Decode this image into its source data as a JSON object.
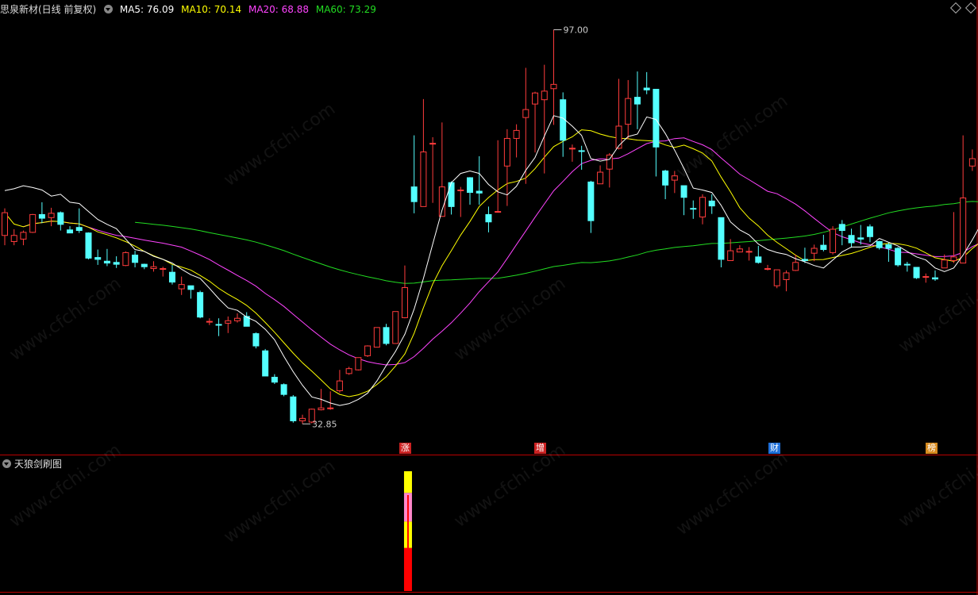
{
  "header": {
    "title": "思泉新材(日线 前复权)",
    "ma5": "MA5: 76.09",
    "ma10": "MA10: 70.14",
    "ma20": "MA20: 68.88",
    "ma60": "MA60: 73.29",
    "colors": {
      "ma5": "#ffffff",
      "ma10": "#ffff00",
      "ma20": "#ff44ff",
      "ma60": "#22dd22"
    }
  },
  "indicator": {
    "title": "天狼剑刷图"
  },
  "annotations": {
    "high": "97.00",
    "low": "32.85"
  },
  "badges": [
    {
      "text": "涨",
      "color": "#cc2222"
    },
    {
      "text": "增",
      "color": "#cc2222"
    },
    {
      "text": "财",
      "color": "#1e6fd9"
    },
    {
      "text": "榜",
      "color": "#d68a1e"
    }
  ],
  "watermark": "www.cfchi.com",
  "chart_data": {
    "type": "candlestick",
    "ylim": [
      30,
      99
    ],
    "colors": {
      "up": "#ff3c3c",
      "down": "#54ffff",
      "ma5": "#ffffff",
      "ma10": "#ffff00",
      "ma20": "#ff44ff",
      "ma60": "#22dd22"
    },
    "candles": [
      [
        63.5,
        67.2,
        67.9,
        61.9
      ],
      [
        62.5,
        63.5,
        64.5,
        61.9
      ],
      [
        62.9,
        64.0,
        64.3,
        61.9
      ],
      [
        64.0,
        66.9,
        67.0,
        63.9
      ],
      [
        66.9,
        66.3,
        68.9,
        65.5
      ],
      [
        66.4,
        67.1,
        68.0,
        65.0
      ],
      [
        67.2,
        65.3,
        67.4,
        64.3
      ],
      [
        64.4,
        63.9,
        65.0,
        63.9
      ],
      [
        64.8,
        64.3,
        67.9,
        63.9
      ],
      [
        63.9,
        59.8,
        64.0,
        59.6
      ],
      [
        59.9,
        59.6,
        61.2,
        58.7
      ],
      [
        59.3,
        59.0,
        61.3,
        58.5
      ],
      [
        59.1,
        58.8,
        60.1,
        58.2
      ],
      [
        58.6,
        60.7,
        60.9,
        58.5
      ],
      [
        60.3,
        59.1,
        61.0,
        58.3
      ],
      [
        58.8,
        58.4,
        58.9,
        58.0
      ],
      [
        58.1,
        58.4,
        59.3,
        57.6
      ],
      [
        58.1,
        58.1,
        58.4,
        56.8
      ],
      [
        57.5,
        55.9,
        58.7,
        55.5
      ],
      [
        54.8,
        55.5,
        56.8,
        53.8
      ],
      [
        55.3,
        54.7,
        55.3,
        53.2
      ],
      [
        54.2,
        50.2,
        54.5,
        50.0
      ],
      [
        49.5,
        49.5,
        50.0,
        48.9
      ],
      [
        49.0,
        48.9,
        50.0,
        47.1
      ],
      [
        49.2,
        49.6,
        50.3,
        47.6
      ],
      [
        49.6,
        50.0,
        50.8,
        49.3
      ],
      [
        50.3,
        48.7,
        51.0,
        48.7
      ],
      [
        47.5,
        45.5,
        47.7,
        45.1
      ],
      [
        44.7,
        40.6,
        45.0,
        40.6
      ],
      [
        40.4,
        39.6,
        40.9,
        39.3
      ],
      [
        39.2,
        37.6,
        39.4,
        37.3
      ],
      [
        37.2,
        33.3,
        37.5,
        33.0
      ],
      [
        33.3,
        33.7,
        34.3,
        32.8
      ],
      [
        33.1,
        35.2,
        35.3,
        32.9
      ],
      [
        35.1,
        35.4,
        38.5,
        35.0
      ],
      [
        35.3,
        35.4,
        38.1,
        35.1
      ],
      [
        38.2,
        39.8,
        41.6,
        37.9
      ],
      [
        41.0,
        41.8,
        42.1,
        40.8
      ],
      [
        41.6,
        43.6,
        43.6,
        41.5
      ],
      [
        43.9,
        45.5,
        45.6,
        43.7
      ],
      [
        45.3,
        48.5,
        48.5,
        45.3
      ],
      [
        48.5,
        45.9,
        49.1,
        45.6
      ],
      [
        45.9,
        51.1,
        51.0,
        47.2
      ],
      [
        50.1,
        55.0,
        58.6,
        50.0
      ],
      [
        71.4,
        69.0,
        79.8,
        67.1
      ],
      [
        68.2,
        77.1,
        85.7,
        68.3
      ],
      [
        78.5,
        78.5,
        79.5,
        68.8
      ],
      [
        66.6,
        71.4,
        81.9,
        68.5
      ],
      [
        72.1,
        68.2,
        72.3,
        66.9
      ],
      [
        70.9,
        70.9,
        71.4,
        66.5
      ],
      [
        72.9,
        70.5,
        73.0,
        68.5
      ],
      [
        70.7,
        70.4,
        76.4,
        68.5
      ],
      [
        66.9,
        65.7,
        68.2,
        64.0
      ],
      [
        67.4,
        67.4,
        79.0,
        67.2
      ],
      [
        74.8,
        79.3,
        80.8,
        68.3
      ],
      [
        79.3,
        80.6,
        81.6,
        76.2
      ],
      [
        82.7,
        84.0,
        90.8,
        71.9
      ],
      [
        84.9,
        86.7,
        86.9,
        77.0
      ],
      [
        85.6,
        87.0,
        91.3,
        73.6
      ],
      [
        87.4,
        88.1,
        97.0,
        81.5
      ],
      [
        85.6,
        79.0,
        86.8,
        76.3
      ],
      [
        77.7,
        77.7,
        78.3,
        75.5
      ],
      [
        77.3,
        77.2,
        78.1,
        74.2
      ],
      [
        72.2,
        65.9,
        72.4,
        63.9
      ],
      [
        71.9,
        73.8,
        74.9,
        72.8
      ],
      [
        74.3,
        76.6,
        76.9,
        71.3
      ],
      [
        77.7,
        81.3,
        89.0,
        77.5
      ],
      [
        81.6,
        85.8,
        88.8,
        79.2
      ],
      [
        86.0,
        84.9,
        90.2,
        80.8
      ],
      [
        87.5,
        87.2,
        90.1,
        86.5
      ],
      [
        87.3,
        77.9,
        87.3,
        73.1
      ],
      [
        74.0,
        71.7,
        74.2,
        69.4
      ],
      [
        72.5,
        73.2,
        74.0,
        70.4
      ],
      [
        71.6,
        69.7,
        71.6,
        66.8
      ],
      [
        67.9,
        67.8,
        69.2,
        66.2
      ],
      [
        66.5,
        69.7,
        70.2,
        65.3
      ],
      [
        69.1,
        68.3,
        70.2,
        67.0
      ],
      [
        66.4,
        59.6,
        66.4,
        58.3
      ],
      [
        59.4,
        61.0,
        62.9,
        60.4
      ],
      [
        60.8,
        61.3,
        61.9,
        60.9
      ],
      [
        60.9,
        60.9,
        61.6,
        59.4
      ],
      [
        60.0,
        59.1,
        61.8,
        58.9
      ],
      [
        58.1,
        58.1,
        58.7,
        57.8
      ],
      [
        55.3,
        57.9,
        57.9,
        54.9
      ],
      [
        56.3,
        57.4,
        57.8,
        54.4
      ],
      [
        57.8,
        59.1,
        60.4,
        57.7
      ],
      [
        59.6,
        59.4,
        61.5,
        59.0
      ],
      [
        60.6,
        61.4,
        62.0,
        59.3
      ],
      [
        61.9,
        61.2,
        63.6,
        60.9
      ],
      [
        60.7,
        64.5,
        65.0,
        60.4
      ],
      [
        65.3,
        64.3,
        66.0,
        61.9
      ],
      [
        63.5,
        62.3,
        64.6,
        61.5
      ],
      [
        63.1,
        62.9,
        65.2,
        62.0
      ],
      [
        64.9,
        63.3,
        65.3,
        62.4
      ],
      [
        62.5,
        61.5,
        62.6,
        61.2
      ],
      [
        62.0,
        61.4,
        62.3,
        59.2
      ],
      [
        61.4,
        58.7,
        61.6,
        58.4
      ],
      [
        58.8,
        58.7,
        59.2,
        57.6
      ],
      [
        58.3,
        56.6,
        58.3,
        56.4
      ],
      [
        56.7,
        56.8,
        57.3,
        55.8
      ],
      [
        56.6,
        56.4,
        57.8,
        56.1
      ],
      [
        58.2,
        59.5,
        60.4,
        59.1
      ],
      [
        59.4,
        60.0,
        67.3,
        59.0
      ],
      [
        59.0,
        69.6,
        79.8,
        59.3
      ],
      [
        74.8,
        76.0,
        77.5,
        74.0
      ],
      [
        76.1,
        73.0,
        81.9,
        73.6
      ],
      [
        69.8,
        71.6,
        77.8,
        68.9
      ]
    ],
    "ma5": [
      70.8,
      71.1,
      71.6,
      71.3,
      70.9,
      69.9,
      70.2,
      68.9,
      68.7,
      67.4,
      66.1,
      65.3,
      64.6,
      62.9,
      61.2,
      60.9,
      60.1,
      59.6,
      59.0,
      58.0,
      57.1,
      56.5,
      54.9,
      53.2,
      51.7,
      51.3,
      50.2,
      49.5,
      48.2,
      46.5,
      43.8,
      41.3,
      39.1,
      37.2,
      36.8,
      36.2,
      35.8,
      36.1,
      36.8,
      37.8,
      39.8,
      42.3,
      44.6,
      47.4,
      51.5,
      56.5,
      62.1,
      67.6,
      72.1,
      73.6,
      74.0,
      73.6,
      71.8,
      70.6,
      70.1,
      71.5,
      74.1,
      76.2,
      79.7,
      83.0,
      82.6,
      81.3,
      79.8,
      76.0,
      75.6,
      75.9,
      78.1,
      79.6,
      80.0,
      82.8,
      82.4,
      80.1,
      77.4,
      74.4,
      71.2,
      70.9,
      70.5,
      68.4,
      65.7,
      64.4,
      63.6,
      62.1,
      61.2,
      60.7,
      60.4,
      59.7,
      59.2,
      58.6,
      58.2,
      59.5,
      60.8,
      61.6,
      61.6,
      61.8,
      63.0,
      62.4,
      61.8,
      60.9,
      60.0,
      59.5,
      58.2,
      57.6,
      58.2,
      60.3,
      62.8,
      65.5,
      69.4
    ]
  },
  "indicator_bar": {
    "segments": [
      {
        "from": 0.0,
        "to": 0.36,
        "color": "#ff0000"
      },
      {
        "from": 0.36,
        "to": 0.58,
        "color": "#ffff00"
      },
      {
        "from": 0.58,
        "to": 0.82,
        "color": "#ff88cc"
      },
      {
        "from": 0.82,
        "to": 1.0,
        "color": "#ffff00"
      }
    ]
  }
}
